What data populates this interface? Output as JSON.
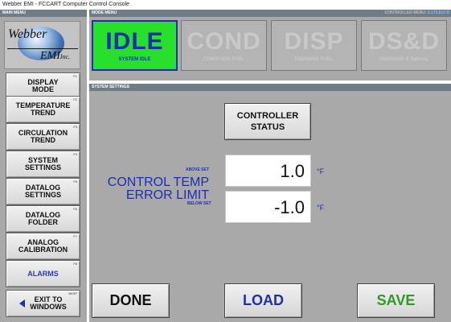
{
  "window": {
    "title": "Webber EMI - FCCART Computer Control Console"
  },
  "sidebar": {
    "header": "MAIN MENU",
    "logo": {
      "brand_main": "Webber",
      "brand_sub": "EMI",
      "brand_suffix": "Inc."
    },
    "items": [
      {
        "line1": "DISPLAY",
        "line2": "MODE",
        "fkey": "F1"
      },
      {
        "line1": "TEMPERATURE",
        "line2": "TREND",
        "fkey": "F2"
      },
      {
        "line1": "CIRCULATION",
        "line2": "TREND",
        "fkey": "F3"
      },
      {
        "line1": "SYSTEM",
        "line2": "SETTINGS",
        "fkey": "F4"
      },
      {
        "line1": "DATALOG",
        "line2": "SETTINGS",
        "fkey": "F5"
      },
      {
        "line1": "DATALOG",
        "line2": "FOLDER",
        "fkey": "F6"
      },
      {
        "line1": "ANALOG",
        "line2": "CALIBRATION",
        "fkey": "F7"
      },
      {
        "line1": "ALARMS",
        "fkey": "F8"
      }
    ],
    "exit": {
      "line1": "EXIT TO",
      "line2": "WINDOWS",
      "fkey": "BKSP"
    }
  },
  "mode_menu": {
    "header": "MODE MENU",
    "controller_label": "CONTROLLER MENU:",
    "controller_version": "5.173.010 B",
    "modes": [
      {
        "big": "IDLE",
        "small": "SYSTEM IDLE",
        "active": true
      },
      {
        "big": "COND",
        "small": "CONDITION FUEL",
        "active": false
      },
      {
        "big": "DISP",
        "small": "DISPENSE FUEL",
        "active": false
      },
      {
        "big": "DS&D",
        "small": "DISPENSE & Datalog",
        "active": false
      }
    ],
    "colors": {
      "active_bg": "#27e02c",
      "active_text": "#1d2fb0",
      "inactive_text": "#c9c9c9"
    }
  },
  "system_settings": {
    "header": "SYSTEM SETTINGS",
    "controller_status": {
      "line1": "CONTROLLER",
      "line2": "STATUS"
    },
    "error_limit": {
      "label_line1": "CONTROL TEMP",
      "label_line2": "ERROR LIMIT",
      "above_label": "ABOVE SET",
      "below_label": "BELOW SET",
      "above_value": "1.0",
      "below_value": "-1.0",
      "unit": "°F"
    }
  },
  "actions": {
    "done": "DONE",
    "load": "LOAD",
    "save": "SAVE"
  }
}
